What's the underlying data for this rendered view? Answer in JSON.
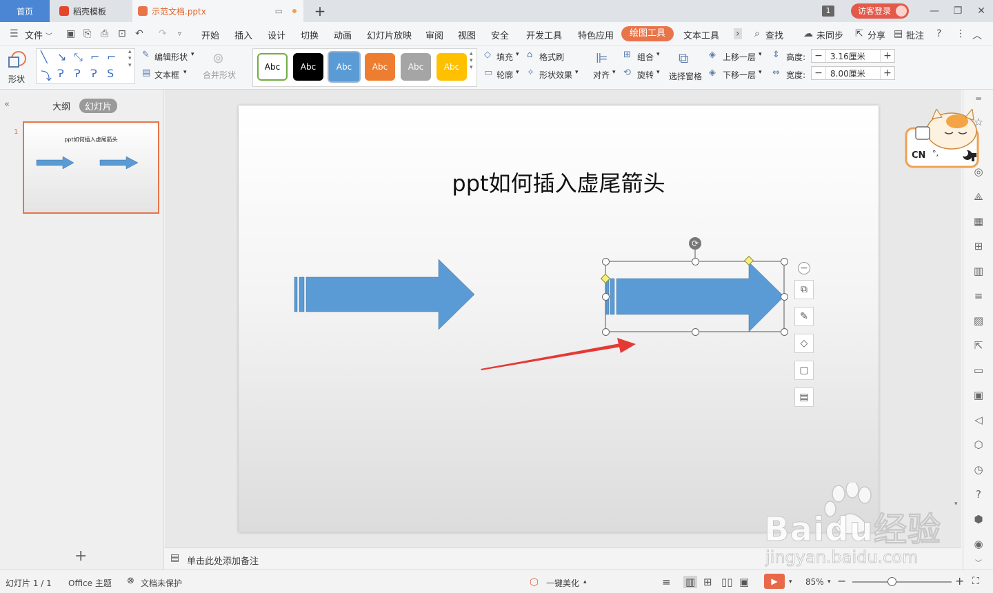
{
  "tabs": {
    "home": "首页",
    "templates": "稻壳模板",
    "document": "示范文档.pptx",
    "add": "+"
  },
  "titlebar": {
    "window_count": "1",
    "login": "访客登录"
  },
  "menu": {
    "file": "文件",
    "items": [
      "开始",
      "插入",
      "设计",
      "切换",
      "动画",
      "幻灯片放映",
      "审阅",
      "视图",
      "安全",
      "开发工具",
      "特色应用",
      "绘图工具",
      "文本工具"
    ],
    "active": "绘图工具",
    "search": "查找",
    "sync": "未同步",
    "share": "分享",
    "comment": "批注"
  },
  "ribbon": {
    "shape": "形状",
    "edit_shape": "编辑形状",
    "text_box": "文本框",
    "merge_shape": "合并形状",
    "style_label": "Abc",
    "fill": "填充",
    "format_painter": "格式刷",
    "outline": "轮廓",
    "shape_effect": "形状效果",
    "align": "对齐",
    "group": "组合",
    "rotate": "旋转",
    "selection_pane": "选择窗格",
    "bring_forward": "上移一层",
    "send_backward": "下移一层",
    "height_label": "高度:",
    "height_value": "3.16厘米",
    "width_label": "宽度:",
    "width_value": "8.00厘米"
  },
  "left_pane": {
    "outline_tab": "大纲",
    "slides_tab": "幻灯片",
    "slide_number": "1",
    "thumb_title": "ppt如何插入虚尾箭头"
  },
  "slide": {
    "title": "ppt如何插入虚尾箭头"
  },
  "notes": {
    "placeholder": "单击此处添加备注"
  },
  "mascot": {
    "text": "CN"
  },
  "status": {
    "slide_info": "幻灯片 1 / 1",
    "theme": "Office 主题",
    "protection": "文档未保护",
    "beautify": "一键美化",
    "zoom": "85%"
  },
  "watermark": {
    "brand": "Baidu经验",
    "url": "jingyan.baidu.com"
  },
  "colors": {
    "accent": "#e8754a",
    "arrow_fill": "#5b9bd5",
    "arrow_stroke": "#41719c",
    "tab_home": "#4a86d4",
    "red_pointer": "#e53935"
  },
  "icons": {
    "right_sidebar": [
      "collapse-icon",
      "star-icon",
      "shape-icon",
      "layers-icon",
      "table-icon",
      "grid-icon",
      "chart-icon",
      "settings-icon",
      "image-icon",
      "share-icon",
      "archive-icon",
      "picture-icon",
      "audio-icon",
      "shield-icon",
      "history-icon",
      "help-icon",
      "cube-icon",
      "location-icon"
    ]
  }
}
